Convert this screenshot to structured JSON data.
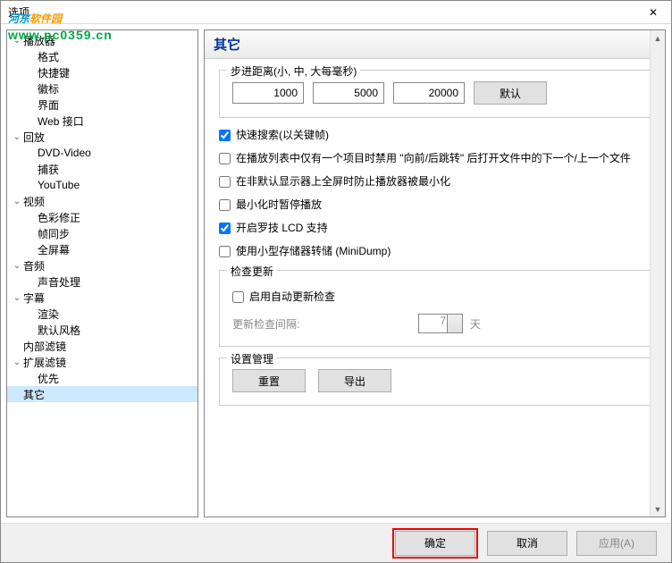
{
  "window": {
    "title": "选项",
    "close": "✕"
  },
  "watermark": {
    "brand1": "河东",
    "brand2": "软件园",
    "url": "www.pc0359.cn"
  },
  "tree": [
    {
      "label": "播放器",
      "depth": 0,
      "caret": "v"
    },
    {
      "label": "格式",
      "depth": 1
    },
    {
      "label": "快捷键",
      "depth": 1
    },
    {
      "label": "徽标",
      "depth": 1
    },
    {
      "label": "界面",
      "depth": 1
    },
    {
      "label": "Web 接口",
      "depth": 1
    },
    {
      "label": "回放",
      "depth": 0,
      "caret": "v"
    },
    {
      "label": "DVD-Video",
      "depth": 1
    },
    {
      "label": "捕获",
      "depth": 1
    },
    {
      "label": "YouTube",
      "depth": 1
    },
    {
      "label": "视频",
      "depth": 0,
      "caret": "v"
    },
    {
      "label": "色彩修正",
      "depth": 1
    },
    {
      "label": "帧同步",
      "depth": 1
    },
    {
      "label": "全屏幕",
      "depth": 1
    },
    {
      "label": "音频",
      "depth": 0,
      "caret": "v"
    },
    {
      "label": "声音处理",
      "depth": 1
    },
    {
      "label": "字幕",
      "depth": 0,
      "caret": "v"
    },
    {
      "label": "渲染",
      "depth": 1
    },
    {
      "label": "默认风格",
      "depth": 1
    },
    {
      "label": "内部滤镜",
      "depth": 0
    },
    {
      "label": "扩展滤镜",
      "depth": 0,
      "caret": "v"
    },
    {
      "label": "优先",
      "depth": 1
    },
    {
      "label": "其它",
      "depth": 0,
      "selected": true
    }
  ],
  "page": {
    "title": "其它",
    "jump": {
      "legend": "步进距离(小, 中, 大每毫秒)",
      "small": "1000",
      "medium": "5000",
      "large": "20000",
      "default_btn": "默认"
    },
    "checks": {
      "fast_seek": {
        "label": "快速搜索(以关键帧)",
        "checked": true
      },
      "disable_next": {
        "label": "在播放列表中仅有一个项目时禁用 \"向前/后跳转\" 后打开文件中的下一个/上一个文件",
        "checked": false
      },
      "prevent_min": {
        "label": "在非默认显示器上全屏时防止播放器被最小化",
        "checked": false
      },
      "pause_min": {
        "label": "最小化时暂停播放",
        "checked": false
      },
      "logitech": {
        "label": "开启罗技 LCD 支持",
        "checked": true
      },
      "minidump": {
        "label": "使用小型存储器转储 (MiniDump)",
        "checked": false
      }
    },
    "updates": {
      "legend": "检查更新",
      "enable_label": "启用自动更新检查",
      "enable_checked": false,
      "interval_label": "更新检查间隔:",
      "interval_value": "7",
      "days": "天"
    },
    "settings_mgr": {
      "legend": "设置管理",
      "reset": "重置",
      "export": "导出"
    }
  },
  "footer": {
    "ok": "确定",
    "cancel": "取消",
    "apply": "应用(A)"
  }
}
